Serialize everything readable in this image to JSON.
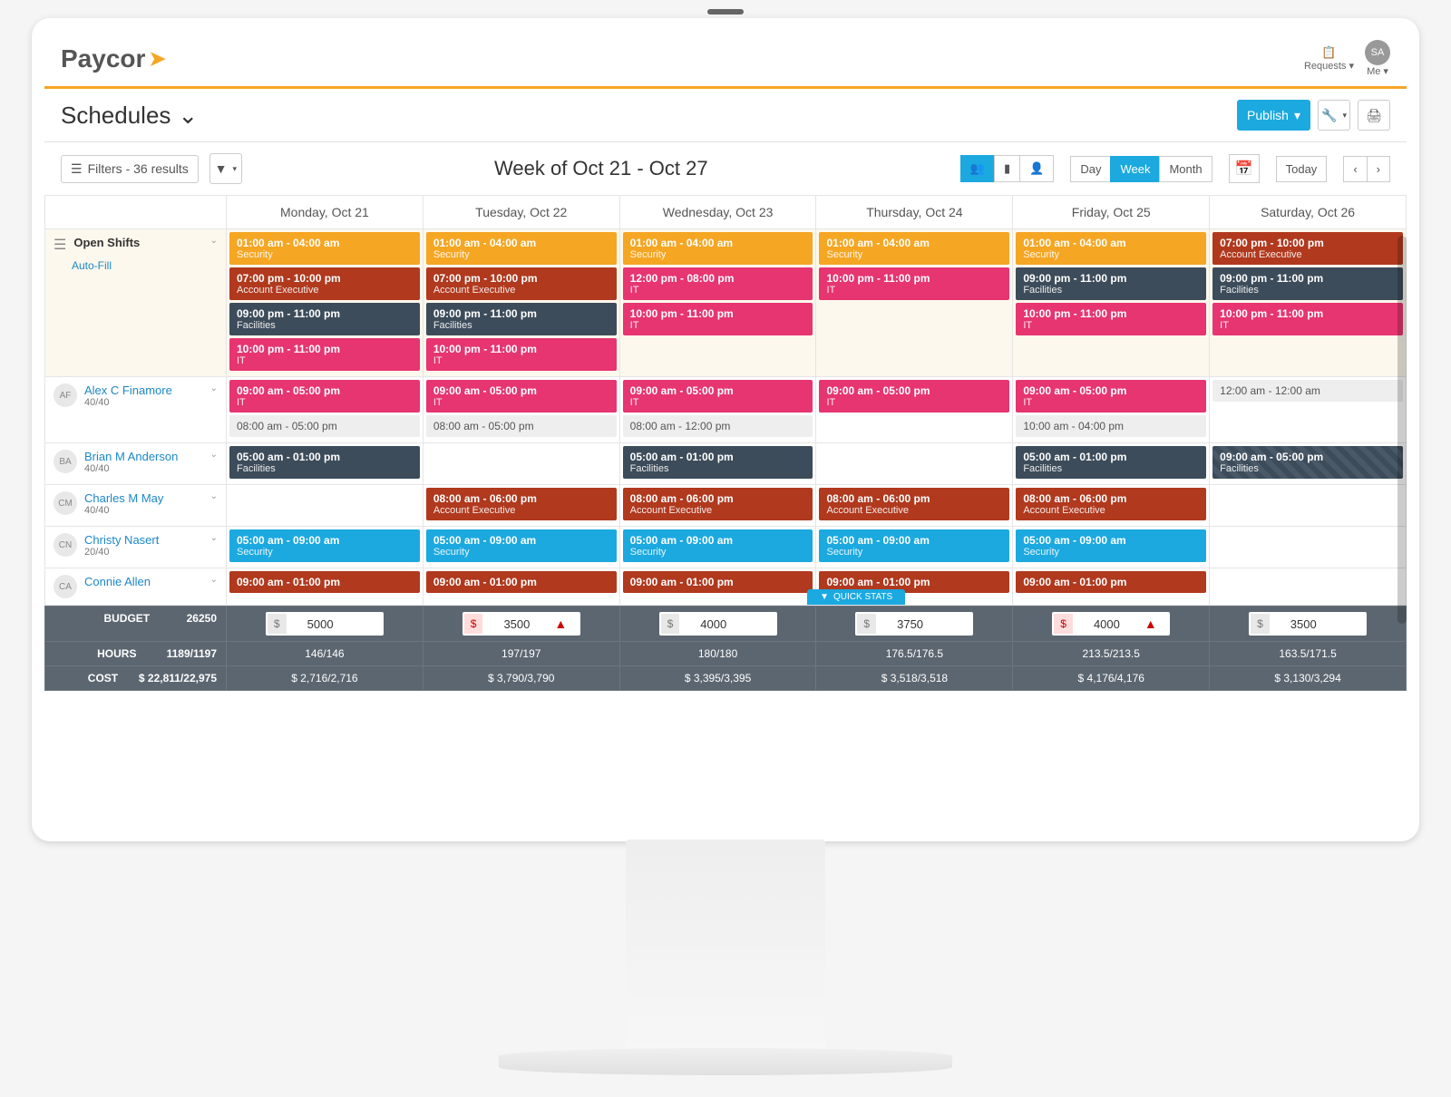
{
  "brand": "Paycor",
  "header": {
    "requests": "Requests",
    "me": "Me",
    "avatar": "SA"
  },
  "page": {
    "title": "Schedules",
    "publish": "Publish",
    "filters": "Filters - 36 results",
    "weekLabel": "Week of Oct 21 - Oct 27",
    "views": {
      "day": "Day",
      "week": "Week",
      "month": "Month",
      "today": "Today"
    }
  },
  "days": [
    "Monday, Oct 21",
    "Tuesday, Oct 22",
    "Wednesday, Oct 23",
    "Thursday, Oct 24",
    "Friday, Oct 25",
    "Saturday, Oct 26"
  ],
  "openShifts": {
    "label": "Open Shifts",
    "autofill": "Auto-Fill",
    "cells": [
      [
        {
          "t": "01:00 am - 04:00 am",
          "r": "Security",
          "c": "orange"
        },
        {
          "t": "07:00 pm - 10:00 pm",
          "r": "Account Executive",
          "c": "brown"
        },
        {
          "t": "09:00 pm - 11:00 pm",
          "r": "Facilities",
          "c": "navy"
        },
        {
          "t": "10:00 pm - 11:00 pm",
          "r": "IT",
          "c": "pink"
        }
      ],
      [
        {
          "t": "01:00 am - 04:00 am",
          "r": "Security",
          "c": "orange"
        },
        {
          "t": "07:00 pm - 10:00 pm",
          "r": "Account Executive",
          "c": "brown"
        },
        {
          "t": "09:00 pm - 11:00 pm",
          "r": "Facilities",
          "c": "navy"
        },
        {
          "t": "10:00 pm - 11:00 pm",
          "r": "IT",
          "c": "pink"
        }
      ],
      [
        {
          "t": "01:00 am - 04:00 am",
          "r": "Security",
          "c": "orange"
        },
        {
          "t": "12:00 pm - 08:00 pm",
          "r": "IT",
          "c": "pink"
        },
        {
          "t": "10:00 pm - 11:00 pm",
          "r": "IT",
          "c": "pink"
        }
      ],
      [
        {
          "t": "01:00 am - 04:00 am",
          "r": "Security",
          "c": "orange"
        },
        {
          "t": "10:00 pm - 11:00 pm",
          "r": "IT",
          "c": "pink"
        }
      ],
      [
        {
          "t": "01:00 am - 04:00 am",
          "r": "Security",
          "c": "orange"
        },
        {
          "t": "09:00 pm - 11:00 pm",
          "r": "Facilities",
          "c": "navy"
        },
        {
          "t": "10:00 pm - 11:00 pm",
          "r": "IT",
          "c": "pink"
        }
      ],
      [
        {
          "t": "07:00 pm - 10:00 pm",
          "r": "Account Executive",
          "c": "brown"
        },
        {
          "t": "09:00 pm - 11:00 pm",
          "r": "Facilities",
          "c": "navy"
        },
        {
          "t": "10:00 pm - 11:00 pm",
          "r": "IT",
          "c": "pink"
        }
      ]
    ]
  },
  "rows": [
    {
      "initials": "AF",
      "name": "Alex C Finamore",
      "hours": "40/40",
      "cells": [
        [
          {
            "t": "09:00 am - 05:00 pm",
            "r": "IT",
            "c": "pink"
          },
          {
            "t": "08:00 am - 05:00 pm",
            "r": "",
            "c": "gray"
          }
        ],
        [
          {
            "t": "09:00 am - 05:00 pm",
            "r": "IT",
            "c": "pink"
          },
          {
            "t": "08:00 am - 05:00 pm",
            "r": "",
            "c": "gray"
          }
        ],
        [
          {
            "t": "09:00 am - 05:00 pm",
            "r": "IT",
            "c": "pink"
          },
          {
            "t": "08:00 am - 12:00 pm",
            "r": "",
            "c": "gray"
          }
        ],
        [
          {
            "t": "09:00 am - 05:00 pm",
            "r": "IT",
            "c": "pink"
          }
        ],
        [
          {
            "t": "09:00 am - 05:00 pm",
            "r": "IT",
            "c": "pink"
          },
          {
            "t": "10:00 am - 04:00 pm",
            "r": "",
            "c": "gray"
          }
        ],
        [
          {
            "t": "12:00 am - 12:00 am",
            "r": "",
            "c": "gray"
          }
        ]
      ]
    },
    {
      "initials": "BA",
      "name": "Brian M Anderson",
      "hours": "40/40",
      "cells": [
        [
          {
            "t": "05:00 am - 01:00 pm",
            "r": "Facilities",
            "c": "navy"
          }
        ],
        [],
        [
          {
            "t": "05:00 am - 01:00 pm",
            "r": "Facilities",
            "c": "navy"
          }
        ],
        [],
        [
          {
            "t": "05:00 am - 01:00 pm",
            "r": "Facilities",
            "c": "navy"
          }
        ],
        [
          {
            "t": "09:00 am - 05:00 pm",
            "r": "Facilities",
            "c": "navyhatch"
          }
        ]
      ]
    },
    {
      "initials": "CM",
      "name": "Charles M May",
      "hours": "40/40",
      "cells": [
        [],
        [
          {
            "t": "08:00 am - 06:00 pm",
            "r": "Account Executive",
            "c": "brown"
          }
        ],
        [
          {
            "t": "08:00 am - 06:00 pm",
            "r": "Account Executive",
            "c": "brown"
          }
        ],
        [
          {
            "t": "08:00 am - 06:00 pm",
            "r": "Account Executive",
            "c": "brown"
          }
        ],
        [
          {
            "t": "08:00 am - 06:00 pm",
            "r": "Account Executive",
            "c": "brown"
          }
        ],
        []
      ]
    },
    {
      "initials": "CN",
      "name": "Christy Nasert",
      "hours": "20/40",
      "cells": [
        [
          {
            "t": "05:00 am - 09:00 am",
            "r": "Security",
            "c": "cyan"
          }
        ],
        [
          {
            "t": "05:00 am - 09:00 am",
            "r": "Security",
            "c": "cyan"
          }
        ],
        [
          {
            "t": "05:00 am - 09:00 am",
            "r": "Security",
            "c": "cyan"
          }
        ],
        [
          {
            "t": "05:00 am - 09:00 am",
            "r": "Security",
            "c": "cyan"
          }
        ],
        [
          {
            "t": "05:00 am - 09:00 am",
            "r": "Security",
            "c": "cyan"
          }
        ],
        []
      ]
    },
    {
      "initials": "CA",
      "name": "Connie Allen",
      "hours": "",
      "cells": [
        [
          {
            "t": "09:00 am - 01:00 pm",
            "r": "",
            "c": "brown"
          }
        ],
        [
          {
            "t": "09:00 am - 01:00 pm",
            "r": "",
            "c": "brown"
          }
        ],
        [
          {
            "t": "09:00 am - 01:00 pm",
            "r": "",
            "c": "brown"
          }
        ],
        [
          {
            "t": "09:00 am - 01:00 pm",
            "r": "",
            "c": "brown"
          }
        ],
        [
          {
            "t": "09:00 am - 01:00 pm",
            "r": "",
            "c": "brown"
          }
        ],
        []
      ]
    }
  ],
  "quickstats": "QUICK STATS",
  "footer": {
    "budgetLabel": "BUDGET",
    "budgetTotal": "26250",
    "budgets": [
      {
        "v": "5000",
        "warn": false
      },
      {
        "v": "3500",
        "warn": true
      },
      {
        "v": "4000",
        "warn": false
      },
      {
        "v": "3750",
        "warn": false
      },
      {
        "v": "4000",
        "warn": true
      },
      {
        "v": "3500",
        "warn": false
      }
    ],
    "hoursLabel": "HOURS",
    "hoursTotal": "1189/1197",
    "hours": [
      "146/146",
      "197/197",
      "180/180",
      "176.5/176.5",
      "213.5/213.5",
      "163.5/171.5"
    ],
    "costLabel": "COST",
    "costTotal": "$ 22,811/22,975",
    "cost": [
      "$ 2,716/2,716",
      "$ 3,790/3,790",
      "$ 3,395/3,395",
      "$ 3,518/3,518",
      "$ 4,176/4,176",
      "$ 3,130/3,294"
    ]
  }
}
